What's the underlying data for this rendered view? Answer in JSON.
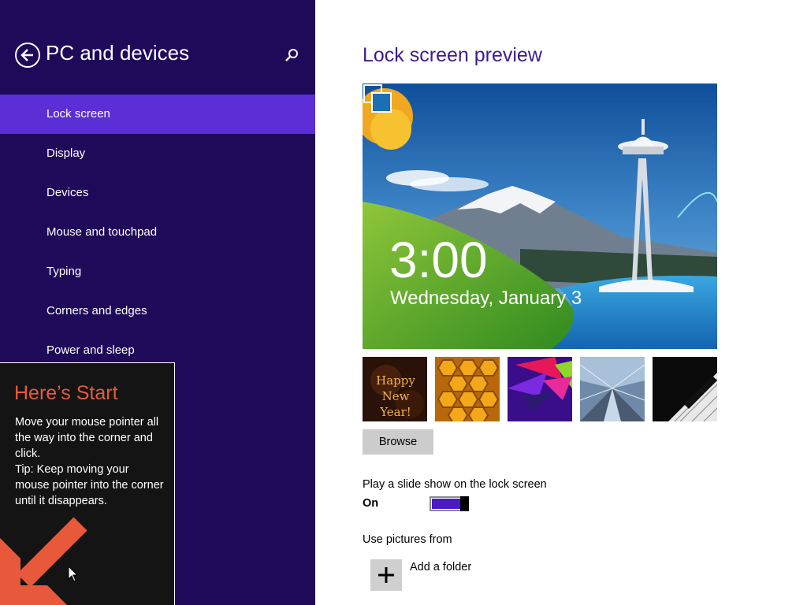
{
  "colors": {
    "left_pane_bg": "#1f0a5a",
    "nav_selected_bg": "#5b2ed6",
    "accent_title": "#3c1e8c",
    "tip_title": "#e8593b",
    "toggle_on": "#4a1ac4"
  },
  "header": {
    "title": "PC and devices",
    "back_icon": "back-arrow-icon",
    "search_icon": "search-icon"
  },
  "nav": {
    "items": [
      {
        "label": "Lock screen",
        "selected": true
      },
      {
        "label": "Display",
        "selected": false
      },
      {
        "label": "Devices",
        "selected": false
      },
      {
        "label": "Mouse and touchpad",
        "selected": false
      },
      {
        "label": "Typing",
        "selected": false
      },
      {
        "label": "Corners and edges",
        "selected": false
      },
      {
        "label": "Power and sleep",
        "selected": false
      }
    ]
  },
  "tip": {
    "title": "Here’s Start",
    "body": "Move your mouse pointer all the way into the corner and click.\nTip: Keep moving your mouse pointer into the corner until it disappears."
  },
  "main": {
    "preview_title": "Lock screen preview",
    "preview": {
      "time": "3:00",
      "date": "Wednesday, January 3"
    },
    "thumbnails": [
      {
        "name": "happy-new-year",
        "text": "Happy\nNew Year!"
      },
      {
        "name": "honeycomb"
      },
      {
        "name": "abstract-shapes"
      },
      {
        "name": "train-station"
      },
      {
        "name": "piano-keys"
      }
    ],
    "browse_label": "Browse",
    "slideshow": {
      "label": "Play a slide show on the lock screen",
      "state": "On",
      "enabled": true
    },
    "use_pictures_label": "Use pictures from",
    "add_folder_label": "Add a folder"
  }
}
